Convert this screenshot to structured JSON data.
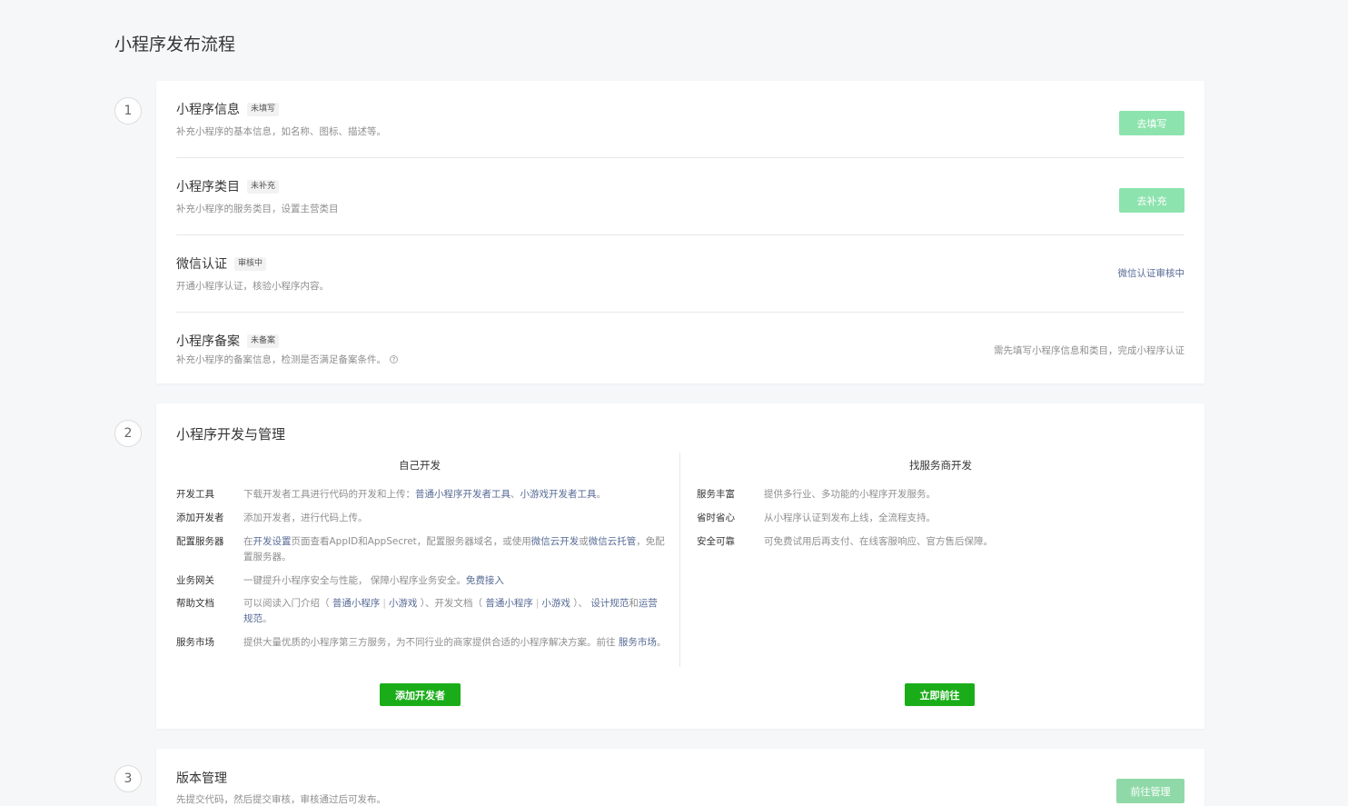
{
  "page_title": "小程序发布流程",
  "steps": [
    "1",
    "2",
    "3"
  ],
  "card1": {
    "rows": [
      {
        "title": "小程序信息",
        "badge": "未填写",
        "desc": "补充小程序的基本信息，如名称、图标、描述等。",
        "action": "去填写"
      },
      {
        "title": "小程序类目",
        "badge": "未补充",
        "desc": "补充小程序的服务类目，设置主营类目",
        "action": "去补充"
      },
      {
        "title": "微信认证",
        "badge": "审核中",
        "desc": "开通小程序认证，核验小程序内容。",
        "status": "微信认证审核中"
      },
      {
        "title": "小程序备案",
        "badge": "未备案",
        "desc": "补充小程序的备案信息，检测是否满足备案条件。",
        "status": "需先填写小程序信息和类目，完成小程序认证",
        "help_icon": "question-circle-icon"
      }
    ]
  },
  "card2": {
    "title": "小程序开发与管理",
    "self_dev": {
      "heading": "自己开发",
      "rows": [
        {
          "label": "开发工具",
          "text_before": "下载开发者工具进行代码的开发和上传：",
          "link1": "普通小程序开发者工具",
          "sep": "、",
          "link2": "小游戏开发者工具",
          "text_after": "。"
        },
        {
          "label": "添加开发者",
          "text": "添加开发者，进行代码上传。"
        },
        {
          "label": "配置服务器",
          "t1": "在",
          "l1": "开发设置",
          "t2": "页面查看AppID和AppSecret，配置服务器域名，或使用",
          "l2": "微信云开发",
          "t3": "或",
          "l3": "微信云托管",
          "t4": "，免配置服务器。"
        },
        {
          "label": "业务网关",
          "text_before": "一键提升小程序安全与性能， 保障小程序业务安全。",
          "link1": "免费接入"
        },
        {
          "label": "帮助文档",
          "t1": "可以阅读入门介绍（ ",
          "l1": "普通小程序",
          "s1": "|",
          "l2": "小游戏",
          "t2": " ）、开发文档（ ",
          "l3": "普通小程序",
          "s2": "|",
          "l4": "小游戏",
          "t3": " ）、 ",
          "l5": "设计规范",
          "t4": "和",
          "l6": "运营规范",
          "t5": "。"
        },
        {
          "label": "服务市场",
          "text_before": "提供大量优质的小程序第三方服务，为不同行业的商家提供合适的小程序解决方案。前往 ",
          "link1": "服务市场",
          "text_after": "。"
        }
      ],
      "button": "添加开发者"
    },
    "provider_dev": {
      "heading": "找服务商开发",
      "rows": [
        {
          "label": "服务丰富",
          "text": "提供多行业、多功能的小程序开发服务。"
        },
        {
          "label": "省时省心",
          "text": "从小程序认证到发布上线，全流程支持。"
        },
        {
          "label": "安全可靠",
          "text": "可免费试用后再支付、在线客服响应、官方售后保障。"
        }
      ],
      "button": "立即前往"
    }
  },
  "card3": {
    "title": "版本管理",
    "desc": "先提交代码，然后提交审核，审核通过后可发布。",
    "action": "前往管理"
  }
}
